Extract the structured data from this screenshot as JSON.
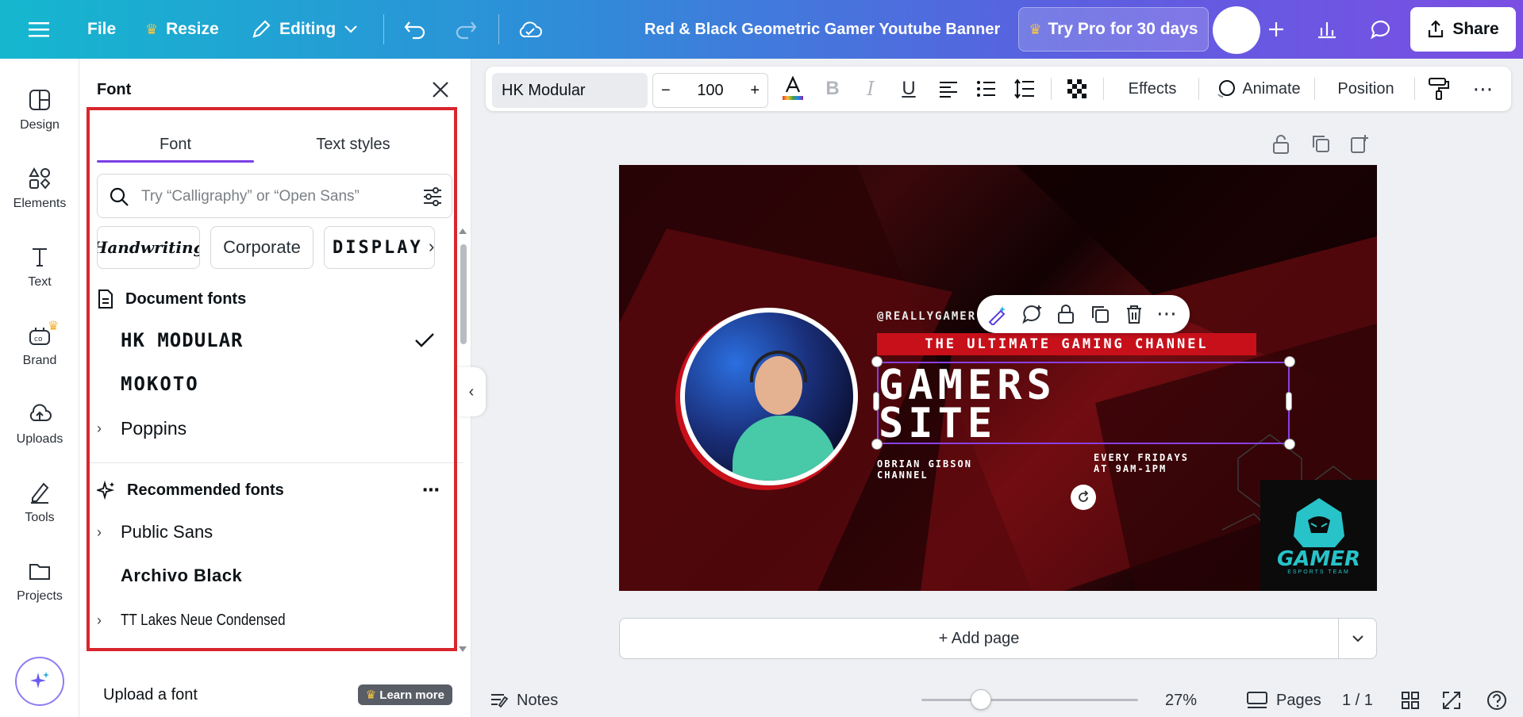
{
  "topbar": {
    "file_label": "File",
    "resize_label": "Resize",
    "editing_label": "Editing",
    "doc_title": "Red & Black Geometric Gamer Youtube Banner",
    "pro_label": "Try Pro for 30 days",
    "share_label": "Share"
  },
  "rail": {
    "items": [
      {
        "label": "Design"
      },
      {
        "label": "Elements"
      },
      {
        "label": "Text"
      },
      {
        "label": "Brand"
      },
      {
        "label": "Uploads"
      },
      {
        "label": "Tools"
      },
      {
        "label": "Projects"
      }
    ]
  },
  "panel": {
    "title": "Font",
    "tabs": [
      "Font",
      "Text styles"
    ],
    "search_placeholder": "Try “Calligraphy” or “Open Sans”",
    "chips": [
      "Handwriting",
      "Corporate",
      "DISPLAY"
    ],
    "document_fonts_heading": "Document fonts",
    "document_fonts": [
      "HK MODULAR",
      "MOKOTO",
      "Poppins"
    ],
    "recommended_heading": "Recommended fonts",
    "recommended_fonts": [
      "Public Sans",
      "Archivo Black",
      "TT Lakes Neue Condensed"
    ],
    "upload_label": "Upload a font",
    "learn_more_label": "Learn more"
  },
  "toolbar": {
    "font_name": "HK Modular",
    "font_size": "100",
    "effects_label": "Effects",
    "animate_label": "Animate",
    "position_label": "Position"
  },
  "design": {
    "handle": "@REALLYGAMER",
    "tagline": "THE ULTIMATE GAMING CHANNEL",
    "headline_1": "GAMERS",
    "headline_2": "SITE",
    "owner_1": "OBRIAN GIBSON",
    "owner_2": "CHANNEL",
    "schedule_1": "EVERY FRIDAYS",
    "schedule_2": "AT 9AM-1PM",
    "logo_text": "GAMER",
    "logo_sub": "ESPORTS TEAM"
  },
  "canvas": {
    "add_page_label": "+ Add page"
  },
  "bottombar": {
    "notes_label": "Notes",
    "zoom_percent": 27,
    "zoom_label": "27%",
    "pages_label": "Pages",
    "page_count": "1 / 1"
  },
  "colors": {
    "highlight": "#d9252d",
    "accent": "#7b3fe4",
    "banner_red": "#c8101a"
  }
}
